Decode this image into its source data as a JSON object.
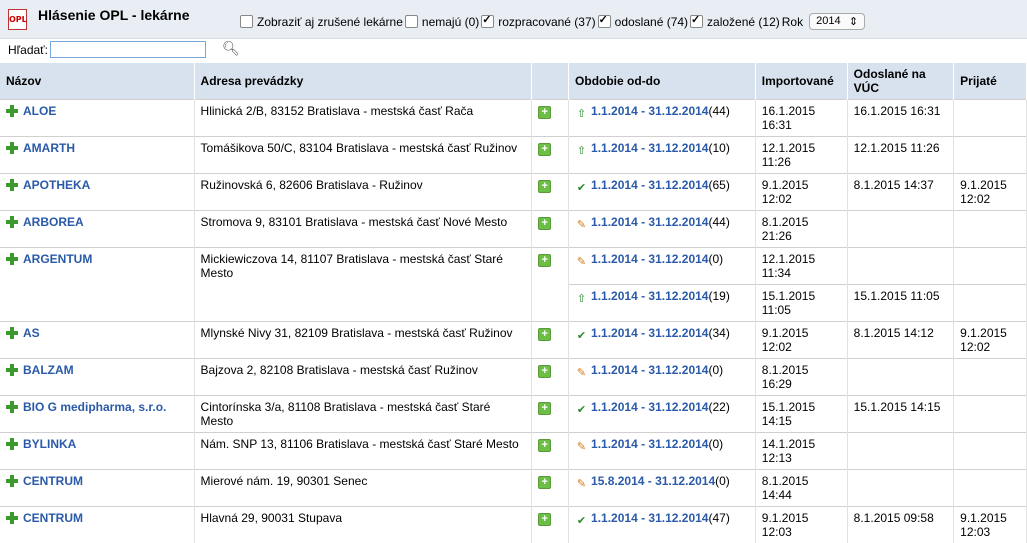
{
  "header": {
    "logo_text": "OPL",
    "title": "Hlásenie OPL - lekárne",
    "filters": [
      {
        "label": "Zobraziť aj zrušené lekárne",
        "checked": false
      },
      {
        "label": "nemajú (0)",
        "checked": false
      },
      {
        "label": "rozpracované (37)",
        "checked": true
      },
      {
        "label": "odoslané (74)",
        "checked": true
      },
      {
        "label": "založené (12)",
        "checked": true
      }
    ],
    "year_label": "Rok",
    "year_value": "2014"
  },
  "search": {
    "label": "Hľadať:",
    "value": ""
  },
  "table": {
    "headers": [
      "Názov",
      "Adresa prevádzky",
      "",
      "Obdobie od-do",
      "Importované",
      "Odoslané na VÚC",
      "Prijaté"
    ],
    "rows": [
      {
        "name": "ALOE",
        "address": "Hlinická 2/B, 83152 Bratislava - mestská časť Rača",
        "periods": [
          {
            "icon": "up",
            "range": "1.1.2014 - 31.12.2014",
            "count": "(44)",
            "imported": "16.1.2015 16:31",
            "sent": "16.1.2015 16:31",
            "received": ""
          }
        ]
      },
      {
        "name": "AMARTH",
        "address": "Tomášikova 50/C, 83104 Bratislava - mestská časť Ružinov",
        "periods": [
          {
            "icon": "up",
            "range": "1.1.2014 - 31.12.2014",
            "count": "(10)",
            "imported": "12.1.2015 11:26",
            "sent": "12.1.2015 11:26",
            "received": ""
          }
        ]
      },
      {
        "name": "APOTHEKA",
        "address": "Ružinovská 6, 82606 Bratislava - Ružinov",
        "periods": [
          {
            "icon": "done",
            "range": "1.1.2014 - 31.12.2014",
            "count": "(65)",
            "imported": "9.1.2015 12:02",
            "sent": "8.1.2015 14:37",
            "received": "9.1.2015 12:02"
          }
        ]
      },
      {
        "name": "ARBOREA",
        "address": "Stromova 9, 83101 Bratislava - mestská časť Nové Mesto",
        "periods": [
          {
            "icon": "draft",
            "range": "1.1.2014 - 31.12.2014",
            "count": "(44)",
            "imported": "8.1.2015 21:26",
            "sent": "",
            "received": ""
          }
        ]
      },
      {
        "name": "ARGENTUM",
        "address": "Mickiewiczova 14, 81107 Bratislava - mestská časť Staré Mesto",
        "periods": [
          {
            "icon": "draft",
            "range": "1.1.2014 - 31.12.2014",
            "count": "(0)",
            "imported": "12.1.2015 11:34",
            "sent": "",
            "received": ""
          },
          {
            "icon": "up",
            "range": "1.1.2014 - 31.12.2014",
            "count": "(19)",
            "imported": "15.1.2015 11:05",
            "sent": "15.1.2015 11:05",
            "received": ""
          }
        ]
      },
      {
        "name": "AS",
        "address": "Mlynské Nivy 31, 82109 Bratislava - mestská časť Ružinov",
        "periods": [
          {
            "icon": "done",
            "range": "1.1.2014 - 31.12.2014",
            "count": "(34)",
            "imported": "9.1.2015 12:02",
            "sent": "8.1.2015 14:12",
            "received": "9.1.2015 12:02"
          }
        ]
      },
      {
        "name": "BALZAM",
        "address": "Bajzova 2, 82108 Bratislava - mestská časť Ružinov",
        "periods": [
          {
            "icon": "draft",
            "range": "1.1.2014 - 31.12.2014",
            "count": "(0)",
            "imported": "8.1.2015 16:29",
            "sent": "",
            "received": ""
          }
        ]
      },
      {
        "name": "BIO G medipharma, s.r.o.",
        "address": "Cintorínska 3/a, 81108 Bratislava - mestská časť Staré Mesto",
        "periods": [
          {
            "icon": "done",
            "range": "1.1.2014 - 31.12.2014",
            "count": "(22)",
            "imported": "15.1.2015 14:15",
            "sent": "15.1.2015 14:15",
            "received": ""
          }
        ]
      },
      {
        "name": "BYLINKA",
        "address": "Nám. SNP 13, 81106 Bratislava - mestská časť Staré Mesto",
        "periods": [
          {
            "icon": "draft",
            "range": "1.1.2014 - 31.12.2014",
            "count": "(0)",
            "imported": "14.1.2015 12:13",
            "sent": "",
            "received": ""
          }
        ]
      },
      {
        "name": "CENTRUM",
        "address": "Mierové nám. 19, 90301 Senec",
        "periods": [
          {
            "icon": "draft",
            "range": "15.8.2014 - 31.12.2014",
            "count": "(0)",
            "imported": "8.1.2015 14:44",
            "sent": "",
            "received": ""
          }
        ]
      },
      {
        "name": "CENTRUM",
        "address": "Hlavná 29, 90031 Stupava",
        "periods": [
          {
            "icon": "done",
            "range": "1.1.2014 - 31.12.2014",
            "count": "(47)",
            "imported": "9.1.2015 12:03",
            "sent": "8.1.2015 09:58",
            "received": "9.1.2015 12:03"
          }
        ]
      }
    ]
  }
}
